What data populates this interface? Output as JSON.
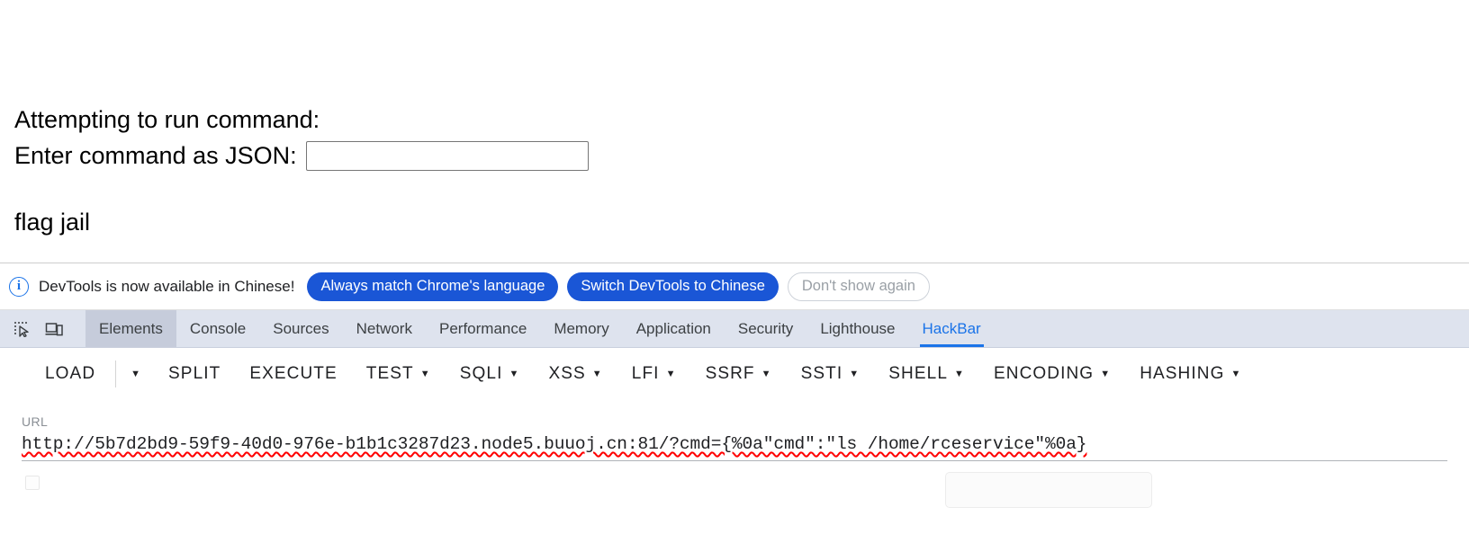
{
  "page": {
    "heading_line1": "Attempting to run command:",
    "heading_line2": "flag jail",
    "form_label": "Enter command as JSON:",
    "input_value": "",
    "input_placeholder": ""
  },
  "devtools": {
    "infobar": {
      "icon": "info-icon",
      "message": "DevTools is now available in Chinese!",
      "buttons": [
        {
          "label": "Always match Chrome's language",
          "style": "primary"
        },
        {
          "label": "Switch DevTools to Chinese",
          "style": "primary"
        },
        {
          "label": "Don't show again",
          "style": "ghost"
        }
      ]
    },
    "toolbar_icons": [
      {
        "name": "inspect-element-icon"
      },
      {
        "name": "device-toolbar-icon"
      }
    ],
    "tabs": [
      {
        "label": "Elements",
        "active": false,
        "highlighted": true
      },
      {
        "label": "Console",
        "active": false,
        "highlighted": false
      },
      {
        "label": "Sources",
        "active": false,
        "highlighted": false
      },
      {
        "label": "Network",
        "active": false,
        "highlighted": false
      },
      {
        "label": "Performance",
        "active": false,
        "highlighted": false
      },
      {
        "label": "Memory",
        "active": false,
        "highlighted": false
      },
      {
        "label": "Application",
        "active": false,
        "highlighted": false
      },
      {
        "label": "Security",
        "active": false,
        "highlighted": false
      },
      {
        "label": "Lighthouse",
        "active": false,
        "highlighted": false
      },
      {
        "label": "HackBar",
        "active": true,
        "highlighted": false
      }
    ]
  },
  "hackbar": {
    "actions": [
      {
        "label": "LOAD",
        "caret": false,
        "split_caret": true
      },
      {
        "label": "SPLIT",
        "caret": false,
        "split_caret": false
      },
      {
        "label": "EXECUTE",
        "caret": false,
        "split_caret": false
      },
      {
        "label": "TEST",
        "caret": true,
        "split_caret": false
      },
      {
        "label": "SQLI",
        "caret": true,
        "split_caret": false
      },
      {
        "label": "XSS",
        "caret": true,
        "split_caret": false
      },
      {
        "label": "LFI",
        "caret": true,
        "split_caret": false
      },
      {
        "label": "SSRF",
        "caret": true,
        "split_caret": false
      },
      {
        "label": "SSTI",
        "caret": true,
        "split_caret": false
      },
      {
        "label": "SHELL",
        "caret": true,
        "split_caret": false
      },
      {
        "label": "ENCODING",
        "caret": true,
        "split_caret": false
      },
      {
        "label": "HASHING",
        "caret": true,
        "split_caret": false
      }
    ],
    "url_label": "URL",
    "url_value": "http://5b7d2bd9-59f9-40d0-976e-b1b1c3287d23.node5.buuoj.cn:81/?cmd={%0a\"cmd\":\"ls /home/rceservice\"%0a}"
  },
  "colors": {
    "accent_blue": "#1a73e8",
    "button_blue": "#1a56d6",
    "tabstrip_bg": "#dee3ee",
    "tab_selected_bg": "#c6ccdb",
    "spellcheck_red": "#ff0000"
  }
}
